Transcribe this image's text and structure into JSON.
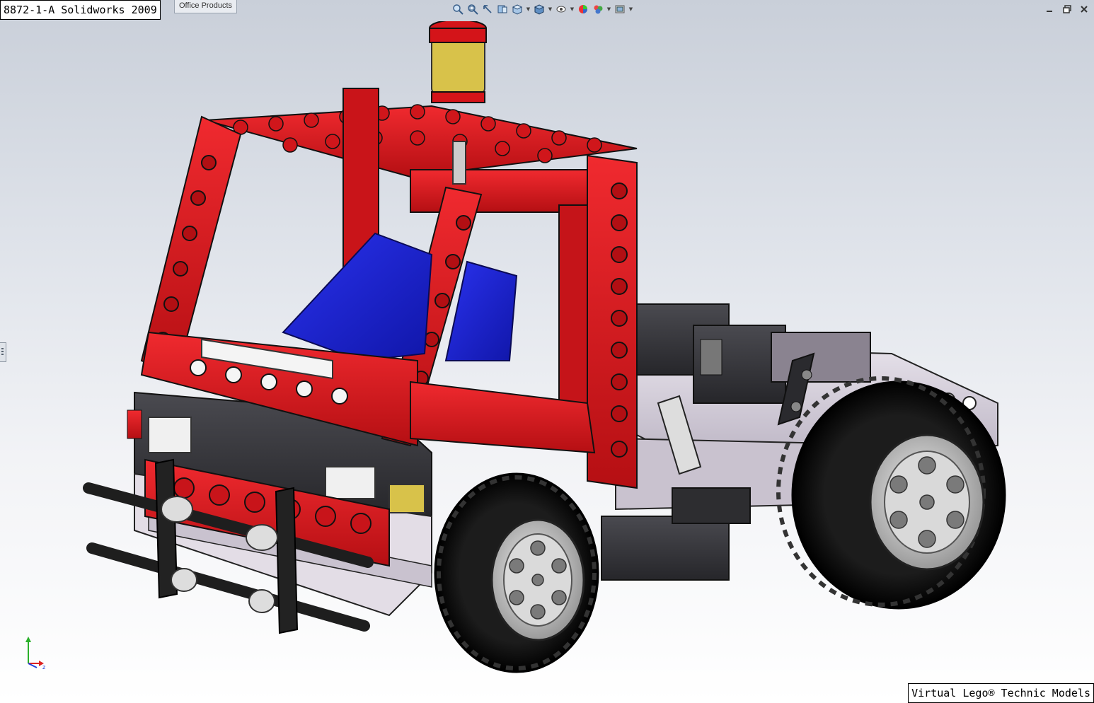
{
  "window": {
    "title": "8872-1-A Solidworks 2009",
    "tab_label": "Office Products",
    "footer": "Virtual Lego® Technic Models"
  },
  "hud_toolbar": {
    "items": [
      {
        "icon": "zoom-to-fit-icon"
      },
      {
        "icon": "zoom-to-area-icon"
      },
      {
        "icon": "previous-view-icon"
      },
      {
        "icon": "section-view-icon"
      },
      {
        "icon": "view-orientation-icon",
        "dropdown": true
      },
      {
        "icon": "display-style-icon",
        "dropdown": true
      },
      {
        "icon": "hide-show-items-icon",
        "dropdown": true
      },
      {
        "icon": "edit-appearance-icon"
      },
      {
        "icon": "apply-scene-icon",
        "dropdown": true
      },
      {
        "icon": "view-settings-icon",
        "dropdown": true
      }
    ]
  },
  "window_controls": [
    "restore-icon",
    "close-icon"
  ],
  "triad": {
    "axes": [
      "y",
      "x",
      "z"
    ]
  },
  "colors": {
    "red": "#e0161b",
    "dark_red": "#9c0b0e",
    "blue": "#1a20d6",
    "dark_gray": "#3b3b3f",
    "light_gray": "#d8d3dc",
    "black": "#111111",
    "yellow": "#d8c24a"
  }
}
